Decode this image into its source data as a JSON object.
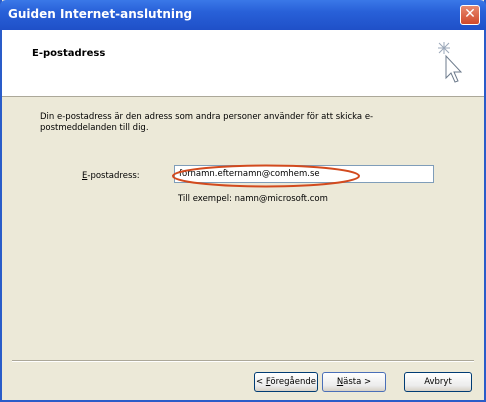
{
  "window": {
    "title": "Guiden Internet-anslutning",
    "close_label": "✕"
  },
  "header": {
    "title": "E-postadress"
  },
  "description": "Din e-postadress är den adress som andra personer använder för att skicka e-postmeddelanden till dig.",
  "email": {
    "label_first": "E",
    "label_rest": "-postadress:",
    "value": "fornamn.efternamn@comhem.se",
    "example": "Till exempel: namn@microsoft.com"
  },
  "buttons": {
    "back_prefix": "< ",
    "back_key": "F",
    "back_rest": "öregående",
    "next_key": "N",
    "next_rest": "ästa >",
    "cancel": "Avbryt"
  },
  "colors": {
    "titlebar": "#2860d8",
    "highlight_oval": "#d24a1e"
  },
  "icons": {
    "wizard": "wizard-sparkle-cursor-icon",
    "close": "close-icon"
  }
}
